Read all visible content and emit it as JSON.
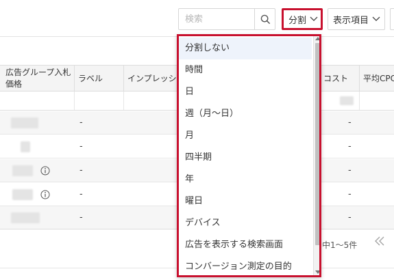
{
  "toolbar": {
    "search_placeholder": "検索",
    "split_label": "分割",
    "display_items_label": "表示項目"
  },
  "table": {
    "headers": {
      "adgroup_bid": "広告グループ入札価格",
      "label": "ラベル",
      "impressions": "インプレッション",
      "cost": "コスト",
      "avg_cpc": "平均CPC"
    },
    "rows": [
      {
        "label": "-",
        "avg_cpc": "-",
        "has_info": false
      },
      {
        "label": "-",
        "avg_cpc": "-",
        "has_info": false
      },
      {
        "label": "-",
        "avg_cpc": "-",
        "has_info": true
      },
      {
        "label": "-",
        "avg_cpc": "-",
        "has_info": true
      },
      {
        "label": "-",
        "avg_cpc": "-",
        "has_info": false
      }
    ]
  },
  "pagination": {
    "range_text": "中1～5件",
    "first_page_icon": "double-chevron-left-icon"
  },
  "split_dropdown": {
    "items": [
      "分割しない",
      "時間",
      "日",
      "週（月～日）",
      "月",
      "四半期",
      "年",
      "曜日",
      "デバイス",
      "広告を表示する検索画面",
      "コンバージョン測定の目的"
    ],
    "selected": "分割しない",
    "highlight_color": "#c8102e"
  }
}
